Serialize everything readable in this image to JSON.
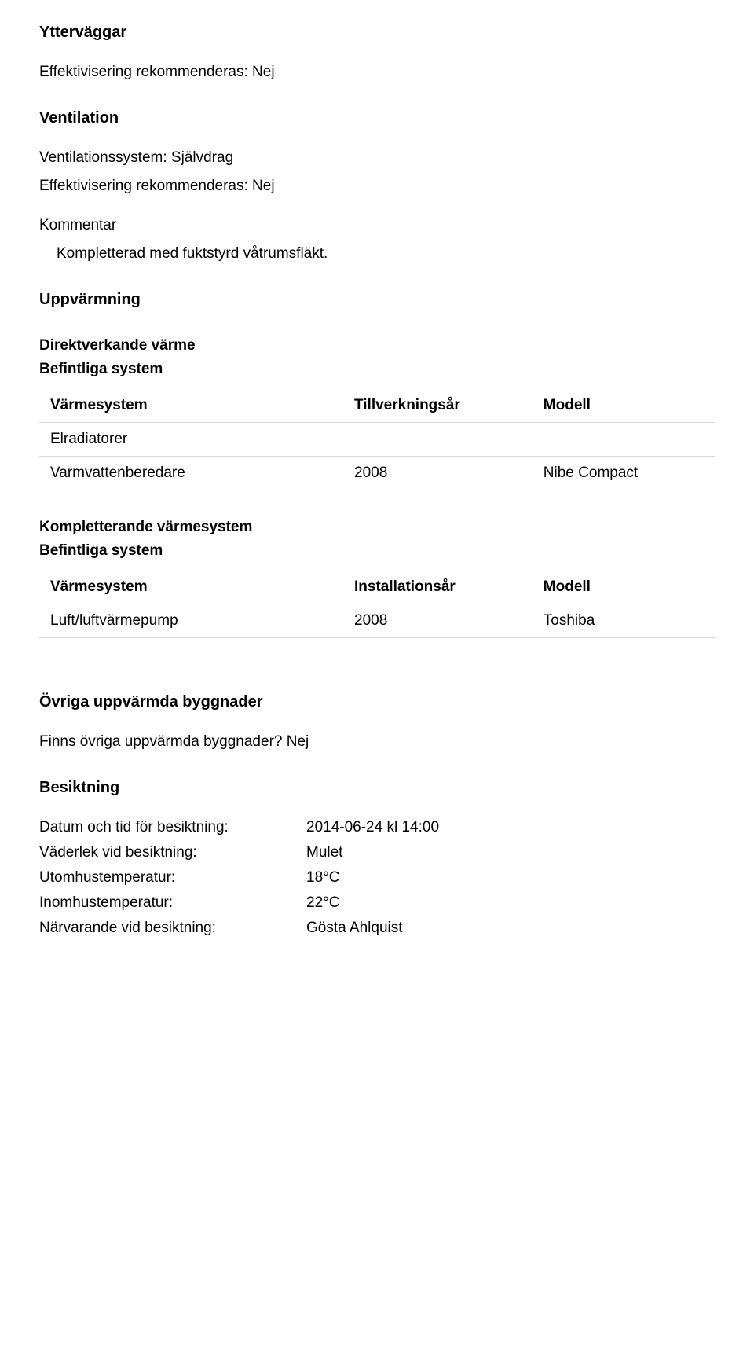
{
  "sections": {
    "yttervaggar": {
      "title": "Ytterväggar",
      "effektivisering_label": "Effektivisering rekommenderas:",
      "effektivisering_value": "Nej"
    },
    "ventilation": {
      "title": "Ventilation",
      "system_label": "Ventilationssystem:",
      "system_value": "Självdrag",
      "effektivisering_label": "Effektivisering rekommenderas:",
      "effektivisering_value": "Nej",
      "kommentar_label": "Kommentar",
      "kommentar_text": "Kompletterad med fuktstyrd våtrumsfläkt."
    },
    "uppvarmning": {
      "title": "Uppvärmning",
      "direkt_title": "Direktverkande värme",
      "befintliga_label": "Befintliga system",
      "table1": {
        "h1": "Värmesystem",
        "h2": "Tillverkningsår",
        "h3": "Modell",
        "rows": [
          {
            "c1": "Elradiatorer",
            "c2": "",
            "c3": ""
          },
          {
            "c1": "Varmvattenberedare",
            "c2": "2008",
            "c3": "Nibe Compact"
          }
        ]
      },
      "kompl_title": "Kompletterande värmesystem",
      "befintliga_label2": "Befintliga system",
      "table2": {
        "h1": "Värmesystem",
        "h2": "Installationsår",
        "h3": "Modell",
        "rows": [
          {
            "c1": "Luft/luftvärmepump",
            "c2": "2008",
            "c3": "Toshiba"
          }
        ]
      }
    },
    "ovriga": {
      "title": "Övriga uppvärmda byggnader",
      "q_label": "Finns övriga uppvärmda byggnader?",
      "q_value": "Nej"
    },
    "besiktning": {
      "title": "Besiktning",
      "rows": [
        {
          "label": "Datum och tid för besiktning:",
          "value": "2014-06-24 kl 14:00"
        },
        {
          "label": "Väderlek vid besiktning:",
          "value": "Mulet"
        },
        {
          "label": "Utomhustemperatur:",
          "value": "18°C"
        },
        {
          "label": "Inomhustemperatur:",
          "value": "22°C"
        },
        {
          "label": "Närvarande vid besiktning:",
          "value": "Gösta Ahlquist"
        }
      ]
    }
  }
}
